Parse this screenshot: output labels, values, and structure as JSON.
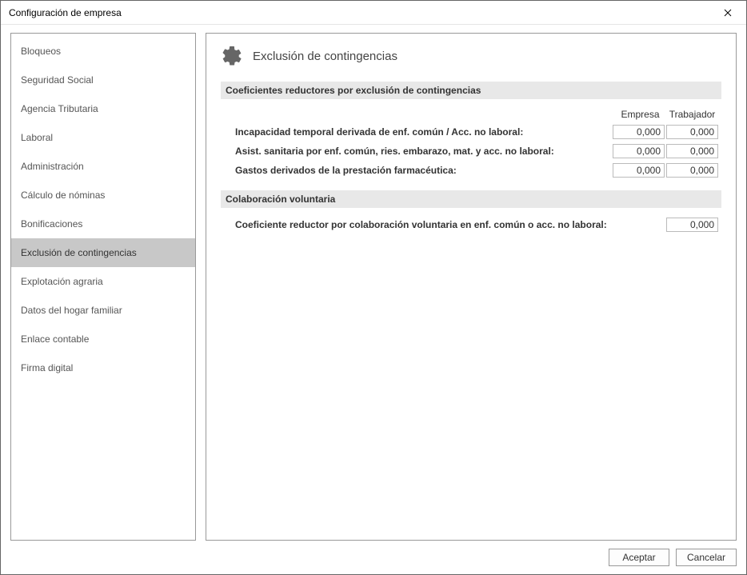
{
  "window": {
    "title": "Configuración de empresa"
  },
  "sidebar": {
    "items": [
      {
        "label": "Bloqueos"
      },
      {
        "label": "Seguridad Social"
      },
      {
        "label": "Agencia Tributaria"
      },
      {
        "label": "Laboral"
      },
      {
        "label": "Administración"
      },
      {
        "label": "Cálculo de nóminas"
      },
      {
        "label": "Bonificaciones"
      },
      {
        "label": "Exclusión de contingencias",
        "selected": true
      },
      {
        "label": "Explotación agraria"
      },
      {
        "label": "Datos del hogar familiar"
      },
      {
        "label": "Enlace contable"
      },
      {
        "label": "Firma digital"
      }
    ]
  },
  "page": {
    "title": "Exclusión de contingencias"
  },
  "section1": {
    "header": "Coeficientes reductores por exclusión de contingencias",
    "col_empresa": "Empresa",
    "col_trabajador": "Trabajador",
    "rows": [
      {
        "label": "Incapacidad temporal derivada de enf. común / Acc. no laboral:",
        "empresa": "0,000",
        "trabajador": "0,000"
      },
      {
        "label": "Asist. sanitaria por enf. común, ries. embarazo, mat. y acc. no laboral:",
        "empresa": "0,000",
        "trabajador": "0,000"
      },
      {
        "label": "Gastos derivados de la prestación farmacéutica:",
        "empresa": "0,000",
        "trabajador": "0,000"
      }
    ]
  },
  "section2": {
    "header": "Colaboración voluntaria",
    "row": {
      "label": "Coeficiente reductor por colaboración voluntaria en enf. común o acc. no laboral:",
      "value": "0,000"
    }
  },
  "footer": {
    "accept": "Aceptar",
    "cancel": "Cancelar"
  }
}
